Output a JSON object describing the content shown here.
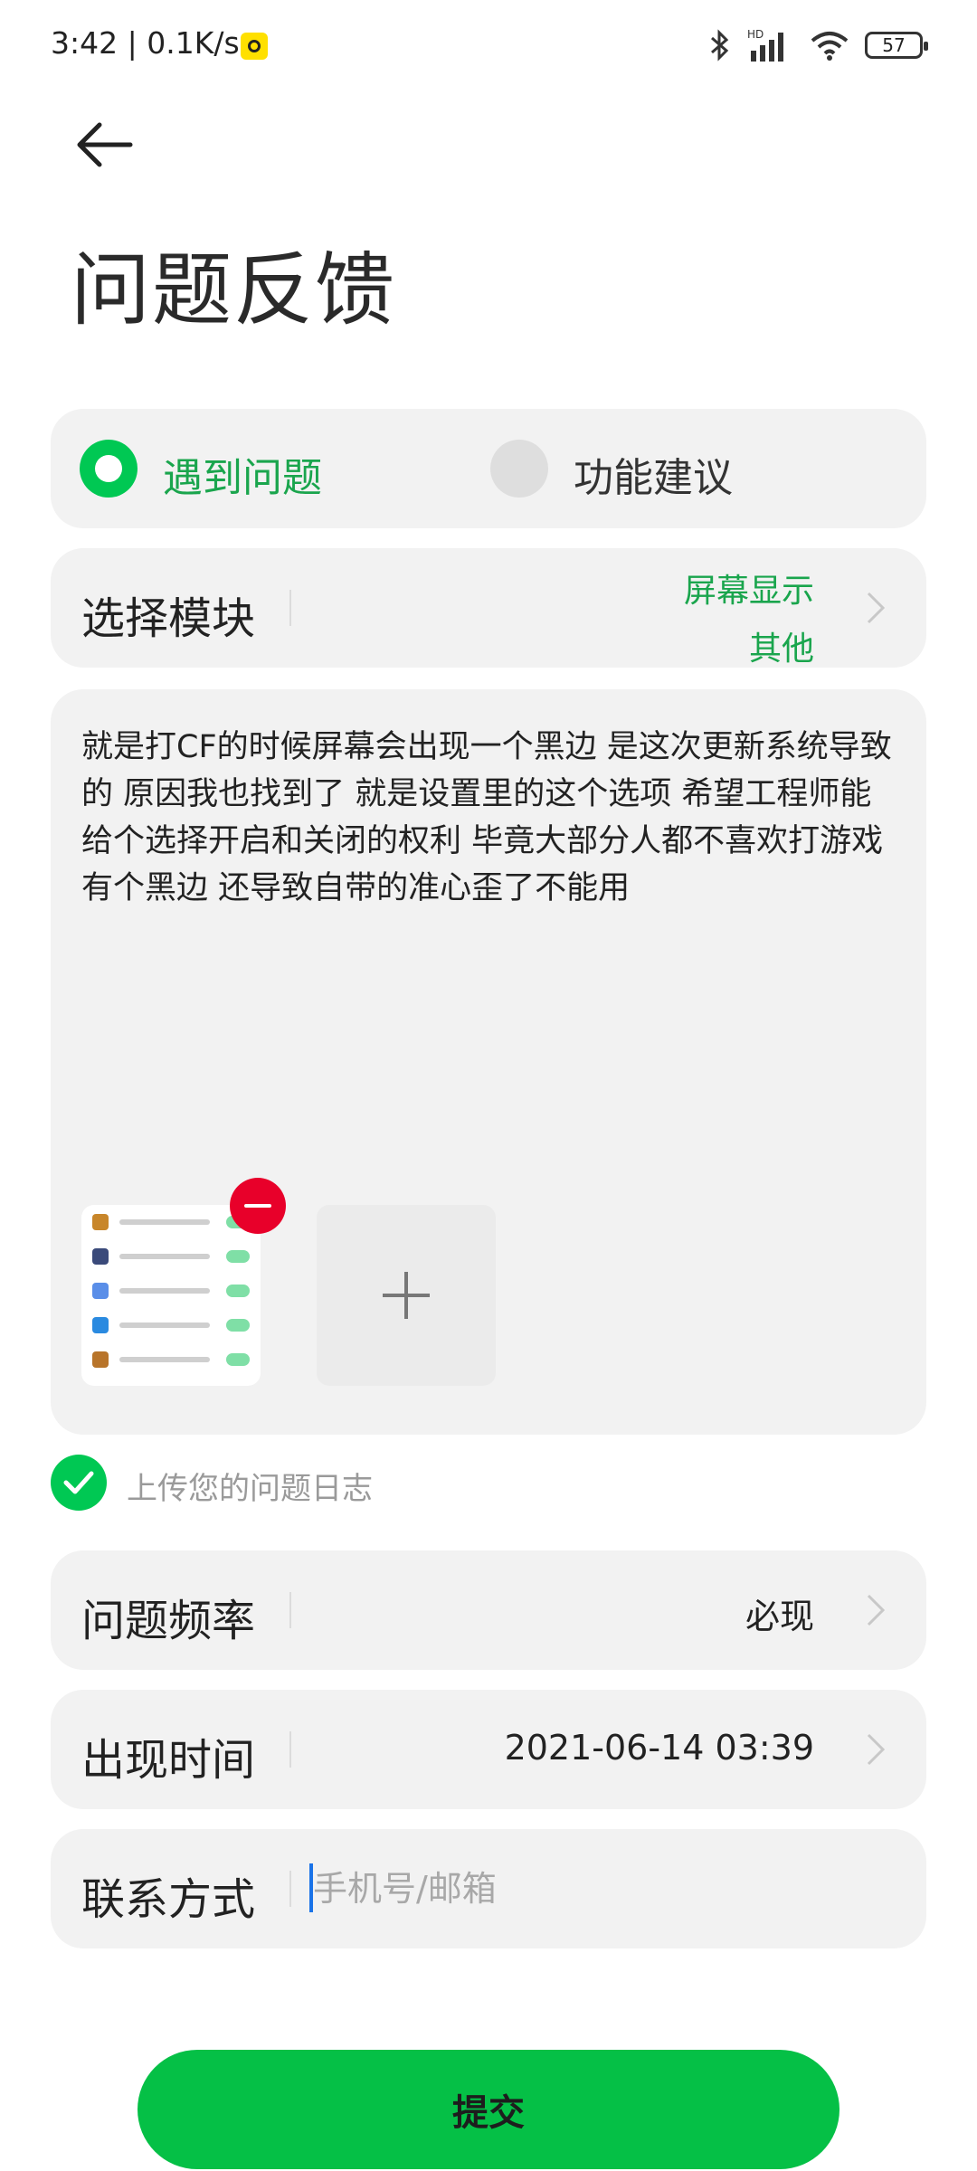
{
  "status_bar": {
    "time": "3:42",
    "speed": "0.1K/s",
    "battery": "57",
    "icons": [
      "bluetooth-icon",
      "signal-hd-icon",
      "wifi-icon",
      "battery-icon"
    ]
  },
  "header": {
    "back_icon": "back-arrow-icon",
    "title": "问题反馈"
  },
  "feedback_type": {
    "options": [
      {
        "label": "遇到问题",
        "selected": true
      },
      {
        "label": "功能建议",
        "selected": false
      }
    ]
  },
  "module": {
    "label": "选择模块",
    "values": [
      "屏幕显示",
      "其他"
    ]
  },
  "description": {
    "text": "就是打CF的时候屏幕会出现一个黑边 是这次更新系统导致的 原因我也找到了 就是设置里的这个选项 希望工程师能给个选择开启和关闭的权利 毕竟大部分人都不喜欢打游戏有个黑边 还导致自带的准心歪了不能用"
  },
  "log_upload": {
    "label": "上传您的问题日志",
    "checked": true
  },
  "frequency": {
    "label": "问题频率",
    "value": "必现"
  },
  "occur_time": {
    "label": "出现时间",
    "value": "2021-06-14 03:39"
  },
  "contact": {
    "label": "联系方式",
    "placeholder": "手机号/邮箱",
    "value": ""
  },
  "submit": {
    "label": "提交"
  },
  "colors": {
    "accent_green": "#00c853",
    "text_green": "#1aa54d",
    "submit_green": "#05c046",
    "remove_red": "#e8002a",
    "card_bg": "#f2f2f2"
  }
}
